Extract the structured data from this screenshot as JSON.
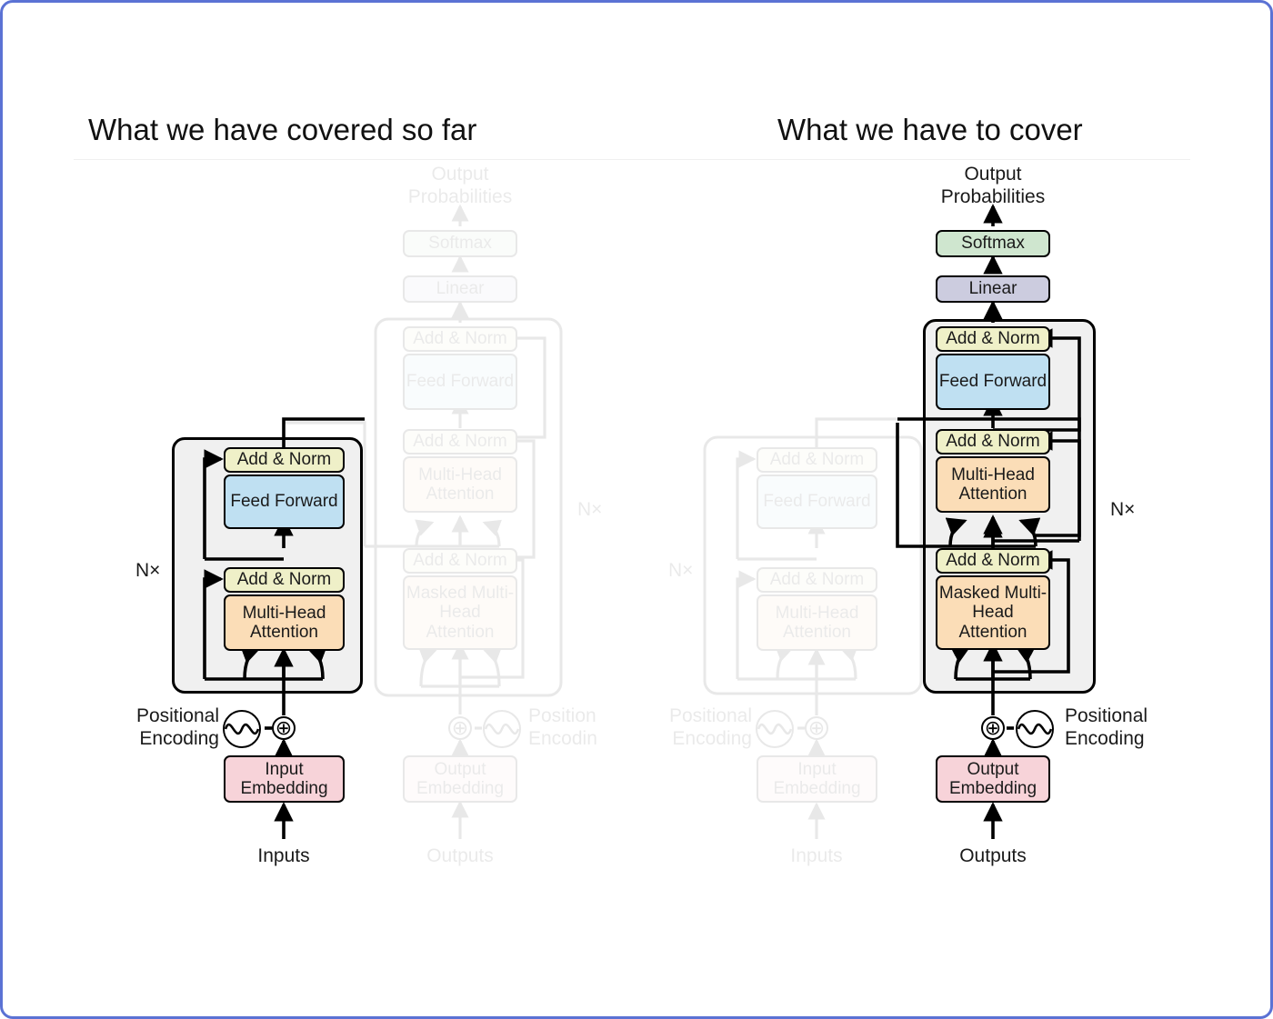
{
  "page": {
    "border_color": "#5b72d4",
    "background": "#ffffff"
  },
  "panels": [
    {
      "id": "left",
      "title": "What we have covered so far",
      "highlighted_stack": "encoder",
      "faded_stack": "decoder"
    },
    {
      "id": "right",
      "title": "What we have to cover",
      "highlighted_stack": "decoder",
      "faded_stack": "encoder"
    }
  ],
  "labels": {
    "output_probabilities": "Output\nProbabilities",
    "softmax": "Softmax",
    "linear": "Linear",
    "add_norm": "Add & Norm",
    "feed_forward": "Feed\nForward",
    "multi_head_attention": "Multi-Head\nAttention",
    "masked_multi_head_attention": "Masked\nMulti-Head\nAttention",
    "input_embedding": "Input\nEmbedding",
    "output_embedding": "Output\nEmbedding",
    "positional_encoding": "Positional\nEncoding",
    "positional_encoding_truncated": "Position\nEncodin",
    "inputs": "Inputs",
    "outputs": "Outputs",
    "nx": "N×"
  },
  "colors": {
    "add_norm": "#eff0c8",
    "feed_forward": "#bfe0f2",
    "attention": "#fbddb7",
    "embedding": "#f7d3d9",
    "softmax": "#cfe6cf",
    "linear": "#ccccdf",
    "outer_block": "#f0f0f0",
    "stroke": "#000000",
    "faded_opacity": "0.085"
  }
}
